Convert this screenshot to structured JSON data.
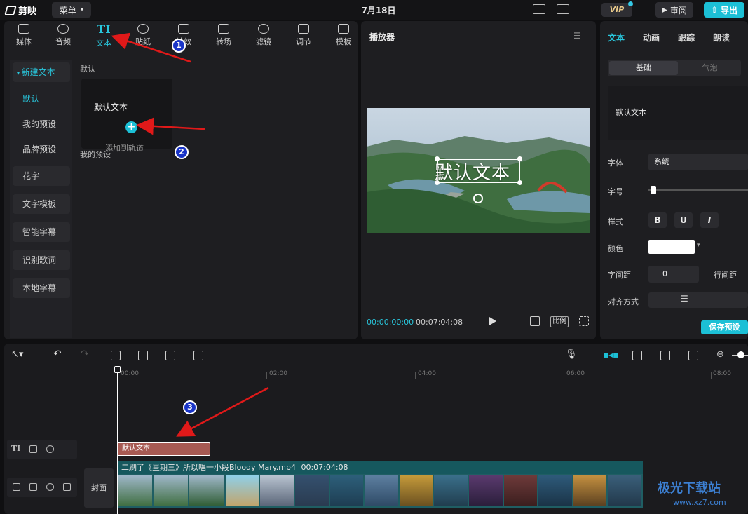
{
  "app": {
    "name": "剪映",
    "menu_label": "菜单",
    "date": "7月18日",
    "vip_label": "VIP",
    "review_label": "审阅",
    "export_label": "导出"
  },
  "tools": [
    {
      "label": "媒体",
      "icon": "media-icon"
    },
    {
      "label": "音频",
      "icon": "audio-icon"
    },
    {
      "label": "文本",
      "icon": "text-icon",
      "glyph": "TI"
    },
    {
      "label": "贴纸",
      "icon": "sticker-icon"
    },
    {
      "label": "特效",
      "icon": "effects-icon"
    },
    {
      "label": "转场",
      "icon": "transition-icon"
    },
    {
      "label": "滤镜",
      "icon": "filter-icon"
    },
    {
      "label": "调节",
      "icon": "adjust-icon"
    },
    {
      "label": "模板",
      "icon": "template-icon"
    }
  ],
  "sidebar": {
    "new_text": "新建文本",
    "sub": [
      "默认",
      "我的预设",
      "品牌预设"
    ],
    "items": [
      "花字",
      "文字模板",
      "智能字幕",
      "识别歌词",
      "本地字幕"
    ]
  },
  "content": {
    "section": "默认",
    "card_text": "默认文本",
    "add_tip": "添加到轨道",
    "my_preset": "我的预设"
  },
  "player": {
    "title": "播放器",
    "overlay_text": "默认文本",
    "time_current": "00:00:00:00",
    "time_total": "00:07:04:08",
    "ratio_label": "比例"
  },
  "props": {
    "tabs": [
      "文本",
      "动画",
      "跟踪",
      "朗读"
    ],
    "seg_basic": "基础",
    "seg_bubble": "气泡",
    "text_value": "默认文本",
    "font_label": "字体",
    "font_value": "系统",
    "size_label": "字号",
    "style_label": "样式",
    "style_buttons": [
      "B",
      "U",
      "I"
    ],
    "color_label": "颜色",
    "letter_spacing_label": "字间距",
    "letter_spacing_value": "0",
    "line_spacing_label": "行间距",
    "align_label": "对齐方式",
    "save_label": "保存预设"
  },
  "timeline": {
    "ticks": [
      "00:00",
      "02:00",
      "04:00",
      "06:00",
      "08:00"
    ],
    "text_clip": "默认文本",
    "video_clip_label": "二刷了《星期三》所以唱一小段Bloody Mary.mp4",
    "video_clip_duration": "00:07:04:08",
    "cover_label": "封面"
  },
  "watermark": {
    "main": "极光下载站",
    "sub": "www.xz7.com"
  },
  "annotations": [
    "1",
    "2",
    "3"
  ],
  "colors": {
    "accent": "#1cc0d6",
    "text_clip": "#a75a53",
    "video_track": "#1f5e63",
    "badge": "#1a35c8",
    "arrow": "#e01919"
  }
}
